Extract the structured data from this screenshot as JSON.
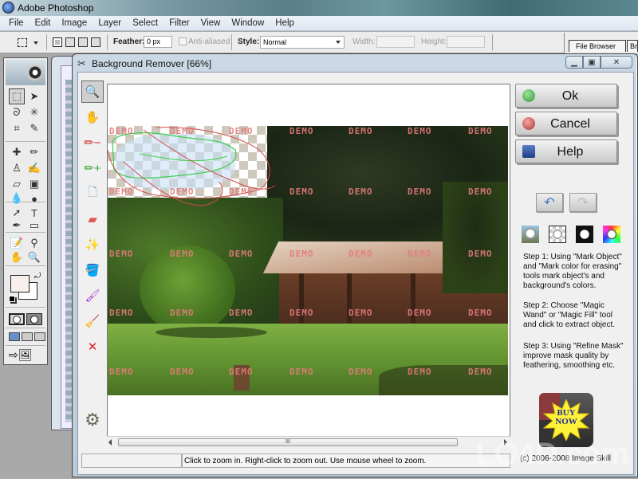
{
  "app": {
    "title": "Adobe Photoshop",
    "menu": [
      "File",
      "Edit",
      "Image",
      "Layer",
      "Select",
      "Filter",
      "View",
      "Window",
      "Help"
    ]
  },
  "options_bar": {
    "feather_label": "Feather:",
    "feather_value": "0 px",
    "anti_aliased_label": "Anti-aliased",
    "style_label": "Style:",
    "style_value": "Normal",
    "width_label": "Width:",
    "width_value": "",
    "height_label": "Height:",
    "height_value": "",
    "palette_tabs": [
      "File Browser",
      "Brushes"
    ]
  },
  "toolbox": {
    "tools": [
      {
        "name": "marquee-tool",
        "glyph": "⬚"
      },
      {
        "name": "move-tool",
        "glyph": "➤"
      },
      {
        "name": "lasso-tool",
        "glyph": "ᘐ"
      },
      {
        "name": "magic-wand-tool",
        "glyph": "✳"
      },
      {
        "name": "crop-tool",
        "glyph": "⌗"
      },
      {
        "name": "slice-tool",
        "glyph": "✎"
      },
      {
        "name": "healing-brush-tool",
        "glyph": "✚"
      },
      {
        "name": "brush-tool",
        "glyph": "✏"
      },
      {
        "name": "clone-stamp-tool",
        "glyph": "♙"
      },
      {
        "name": "history-brush-tool",
        "glyph": "✍"
      },
      {
        "name": "eraser-tool",
        "glyph": "▱"
      },
      {
        "name": "gradient-tool",
        "glyph": "▣"
      },
      {
        "name": "blur-tool",
        "glyph": "💧"
      },
      {
        "name": "dodge-tool",
        "glyph": "●"
      },
      {
        "name": "path-selection-tool",
        "glyph": "➚"
      },
      {
        "name": "type-tool",
        "glyph": "T"
      },
      {
        "name": "pen-tool",
        "glyph": "✒"
      },
      {
        "name": "shape-tool",
        "glyph": "▭"
      },
      {
        "name": "notes-tool",
        "glyph": "📝"
      },
      {
        "name": "eyedropper-tool",
        "glyph": "⚲"
      },
      {
        "name": "hand-tool",
        "glyph": "✋"
      },
      {
        "name": "zoom-tool",
        "glyph": "🔍"
      }
    ],
    "foreground_color": "#f8eeec",
    "background_color": "#ffffff"
  },
  "dialog": {
    "title": "Background Remover [66%]",
    "tools": [
      {
        "name": "zoom-tool",
        "glyph": "🔍"
      },
      {
        "name": "hand-tool",
        "glyph": "✋"
      },
      {
        "name": "mark-color-for-erasing-tool",
        "glyph": "✏−"
      },
      {
        "name": "mark-object-tool",
        "glyph": "✏+"
      },
      {
        "name": "new-document-tool",
        "glyph": "🗋"
      },
      {
        "name": "eraser-tool",
        "glyph": "▰"
      },
      {
        "name": "magic-wand-tool",
        "glyph": "✨"
      },
      {
        "name": "magic-fill-tool",
        "glyph": "🪣"
      },
      {
        "name": "refine-mask-brush-tool",
        "glyph": "🖌"
      },
      {
        "name": "broom-tool",
        "glyph": "🧹"
      },
      {
        "name": "clear-tool",
        "glyph": "✕"
      }
    ],
    "buttons": {
      "ok": "Ok",
      "cancel": "Cancel",
      "help": "Help"
    },
    "steps": [
      "Step 1: Using \"Mark Object\" and \"Mark color for erasing\" tools mark object's and background's colors.",
      "Step 2: Choose \"Magic Wand\" or \"Magic Fill\" tool and click to extract object.",
      "Step 3: Using \"Refine Mask\" improve mask quality by feathering, smoothing etc."
    ],
    "buy_now": "BUY NOW",
    "copyright": "(c) 2006-2008 Image Skill",
    "status_text": "Click to zoom in. Right-click to zoom out. Use mouse wheel to zoom.",
    "scroll_grip": "III",
    "watermark_word": "DEMO"
  },
  "watermark": "LO4D.com"
}
